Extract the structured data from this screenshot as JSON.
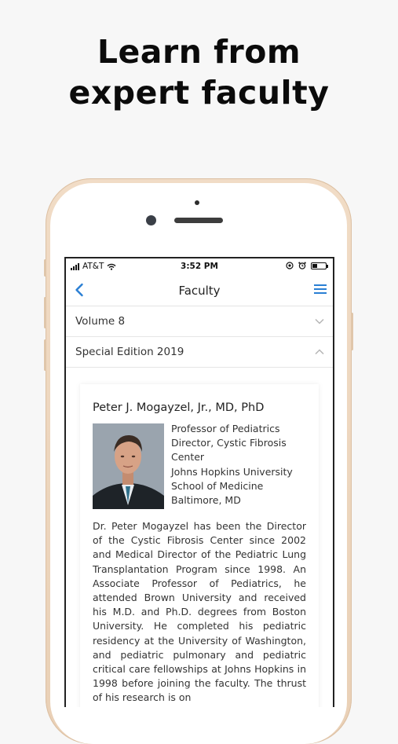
{
  "headline": {
    "line1": "Learn from",
    "line2": "expert faculty"
  },
  "status_bar": {
    "carrier": "AT&T",
    "time": "3:52 PM",
    "battery_level": 0.4
  },
  "nav": {
    "title": "Faculty",
    "back_icon": "chevron-left-icon",
    "menu_icon": "menu-icon"
  },
  "accordion": [
    {
      "label": "Volume 8",
      "expanded": false
    },
    {
      "label": "Special Edition 2019",
      "expanded": true
    }
  ],
  "faculty": {
    "name": "Peter J. Mogayzel, Jr., MD, PhD",
    "affiliation_lines": [
      "Professor of Pediatrics",
      "Director, Cystic Fibrosis",
      "Center",
      "Johns Hopkins University",
      "School of Medicine",
      "Baltimore, MD"
    ],
    "bio": "Dr. Peter Mogayzel has been the Director of the Cystic Fibrosis Center since 2002 and Medical Director of the Pediatric Lung Transplantation Program since 1998. An Associate Professor of Pediatrics, he attended Brown University and received his M.D. and Ph.D. degrees from Boston University. He completed his pediatric residency at the University of Washington, and pediatric pulmonary and pediatric critical care fellowships at Johns Hopkins in 1998 before joining the faculty. The thrust of his research is on"
  },
  "colors": {
    "accent": "#2a7fd4",
    "phone_gold": "#ecd5bd"
  }
}
